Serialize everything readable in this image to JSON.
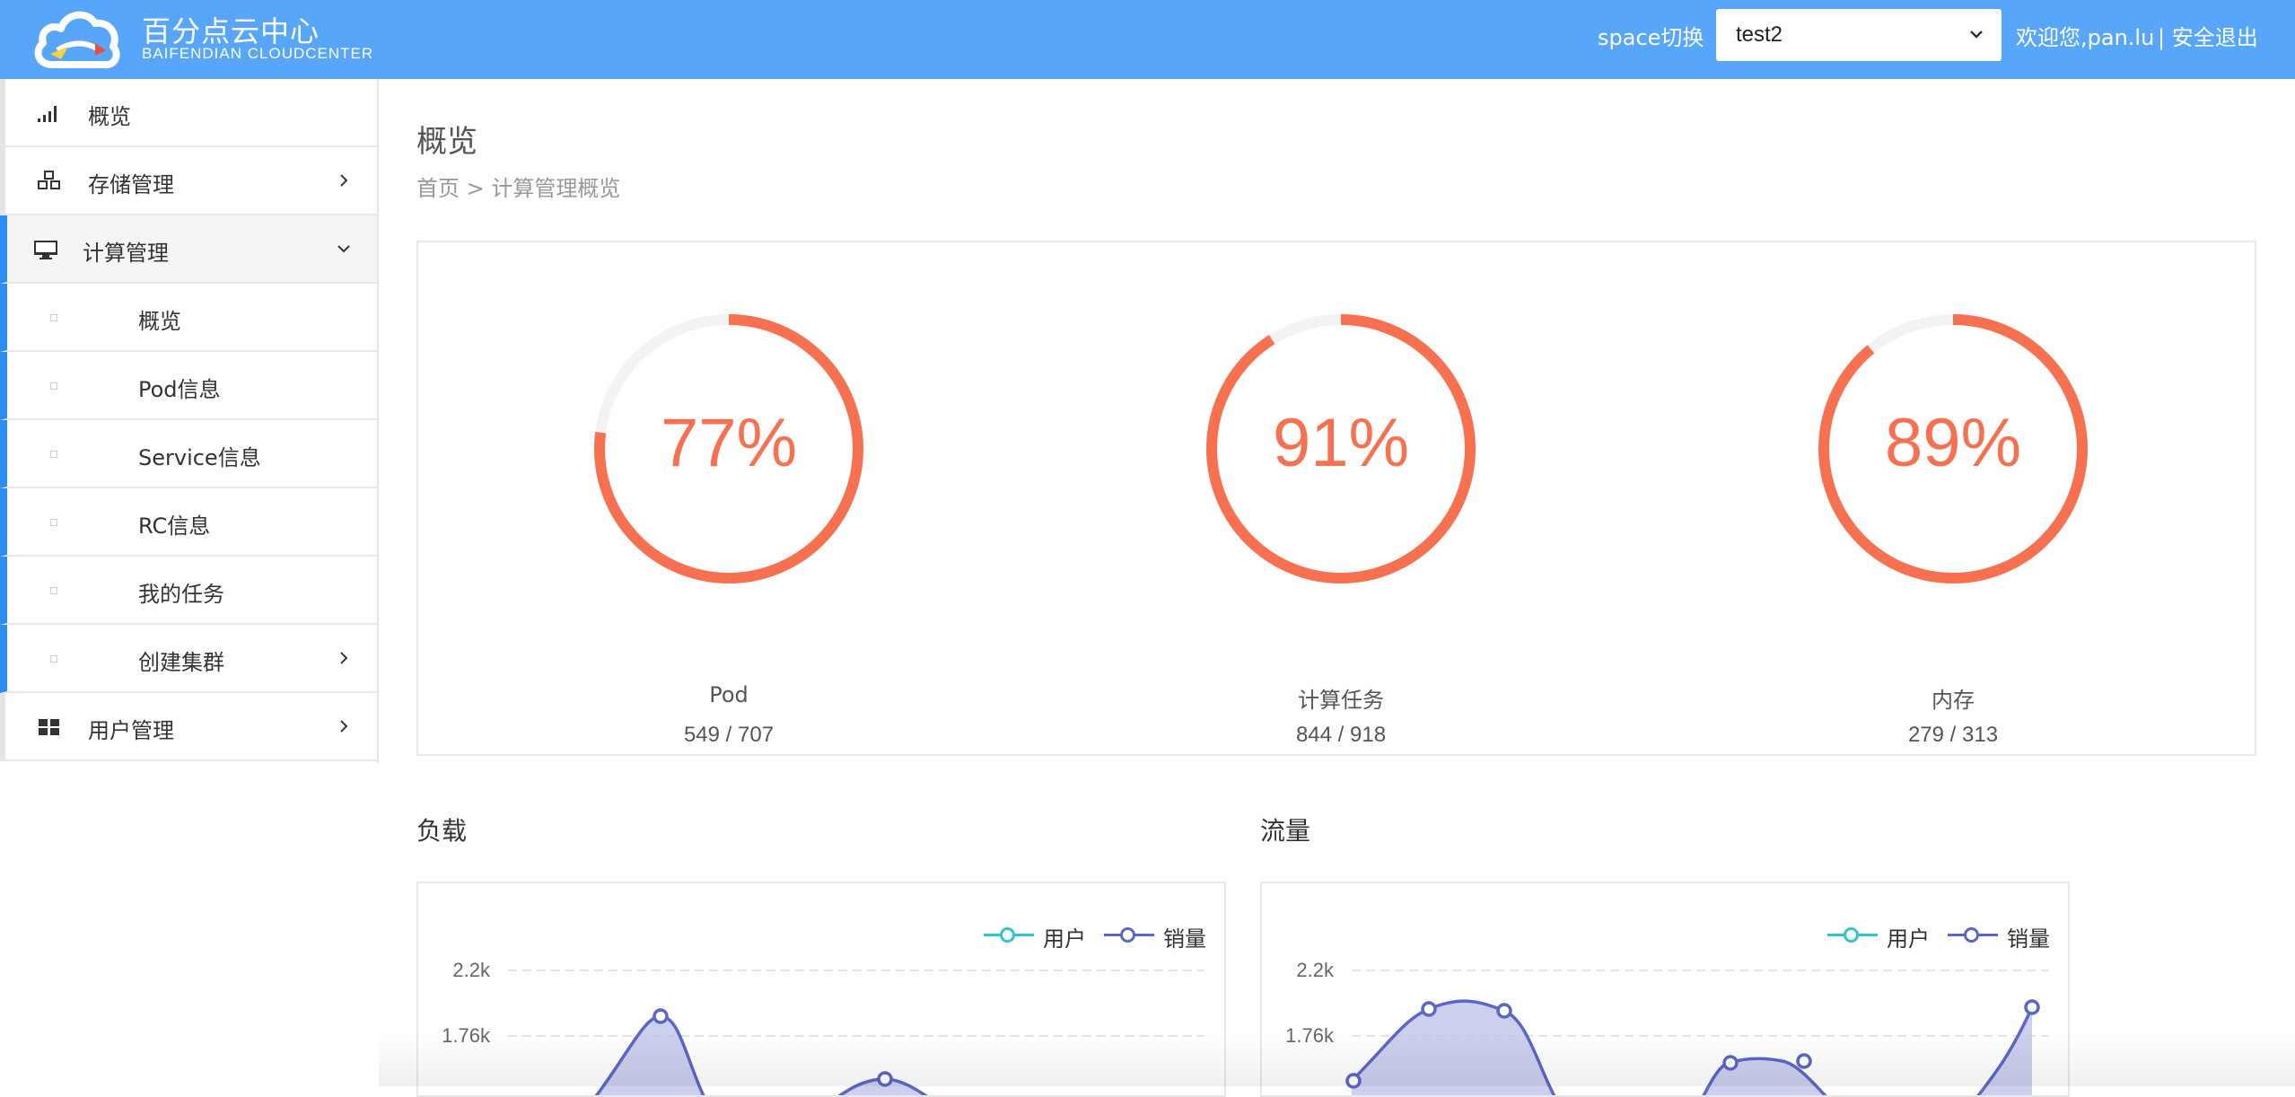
{
  "header": {
    "brand_cn": "百分点云中心",
    "brand_en": "BAIFENDIAN CLOUDCENTER",
    "space_label": "space切换",
    "space_value": "test2",
    "welcome": "欢迎您,pan.lu",
    "logout": "| 安全退出",
    "bg_color": "#57a6fa"
  },
  "sidebar": {
    "items": [
      {
        "label": "概览",
        "icon": "signal-bars-icon"
      },
      {
        "label": "存储管理",
        "icon": "cubes-icon"
      },
      {
        "label": "计算管理",
        "icon": "desktop-icon"
      },
      {
        "label": "用户管理",
        "icon": "grid-icon"
      }
    ],
    "subitems": [
      {
        "label": "概览"
      },
      {
        "label": "Pod信息"
      },
      {
        "label": "Service信息"
      },
      {
        "label": "RC信息"
      },
      {
        "label": "我的任务"
      },
      {
        "label": "创建集群"
      }
    ],
    "active_color": "#2d8cf0"
  },
  "main": {
    "title": "概览",
    "breadcrumb": "首页 > 计算管理概览",
    "gauges": [
      {
        "percent_text": "77%",
        "percent": 0.77,
        "name": "Pod",
        "count": "549 / 707"
      },
      {
        "percent_text": "91%",
        "percent": 0.91,
        "name": "计算任务",
        "count": "844 / 918"
      },
      {
        "percent_text": "89%",
        "percent": 0.89,
        "name": "内存",
        "count": "279 / 313"
      }
    ],
    "gauge_color": "#f7704f",
    "load_title": "负载",
    "traffic_title": "流量"
  },
  "chart_data": [
    {
      "type": "area",
      "title": "负载",
      "legend": [
        "用户",
        "销量"
      ],
      "legend_placement": "top-right",
      "y_ticks": [
        "2.2k",
        "1.76k"
      ],
      "series": [
        {
          "name": "用户",
          "color": "#2ec7c9"
        },
        {
          "name": "销量",
          "color": "#5b67c7",
          "visible_points": [
            1850,
            1300
          ]
        }
      ]
    },
    {
      "type": "area",
      "title": "流量",
      "legend": [
        "用户",
        "销量"
      ],
      "legend_placement": "top-right",
      "y_ticks": [
        "2.2k",
        "1.76k"
      ],
      "series": [
        {
          "name": "用户",
          "color": "#2ec7c9"
        },
        {
          "name": "销量",
          "color": "#5b67c7",
          "visible_points": [
            1300,
            1880,
            1880,
            1450,
            1450,
            1900
          ]
        }
      ]
    }
  ]
}
